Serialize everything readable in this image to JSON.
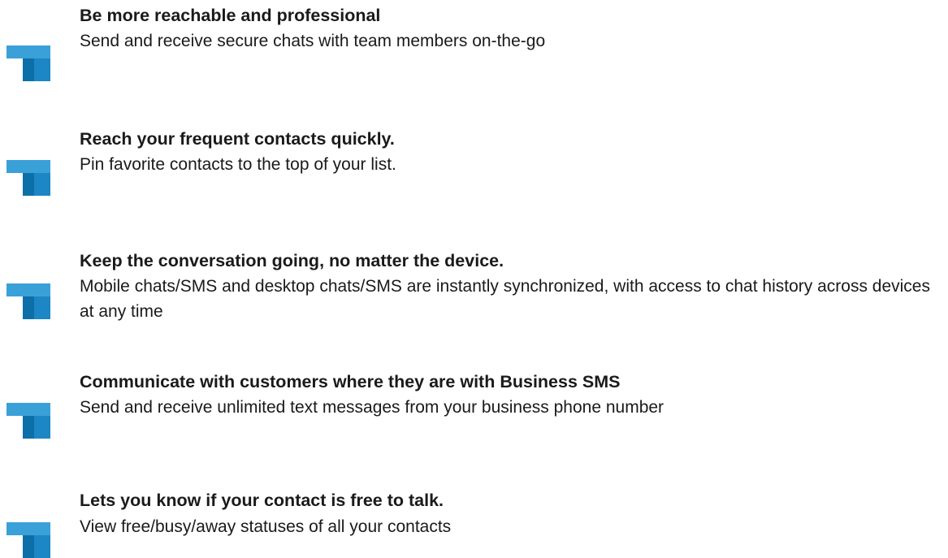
{
  "colors": {
    "icon_light": "#3aa0d8",
    "icon_dark": "#0d6fa8",
    "text": "#1a1a1a"
  },
  "features": [
    {
      "icon": "brand-corner-icon",
      "title": "Be more reachable and professional",
      "description": "Send and receive secure chats with team members on-the-go"
    },
    {
      "icon": "brand-corner-icon",
      "title": "Reach your frequent contacts quickly.",
      "description": "Pin favorite contacts to the top of your list."
    },
    {
      "icon": "brand-corner-icon",
      "title": "Keep the conversation going, no matter the device.",
      "description": "Mobile chats/SMS and desktop chats/SMS are instantly synchronized, with access to chat history across devices at any time"
    },
    {
      "icon": "brand-corner-icon",
      "title": "Communicate with customers where they are with Business SMS",
      "description": "Send and receive unlimited text messages from your business phone number"
    },
    {
      "icon": "brand-corner-icon",
      "title": "Lets you know if your contact is free to talk.",
      "description": "View free/busy/away statuses of all your contacts"
    }
  ]
}
